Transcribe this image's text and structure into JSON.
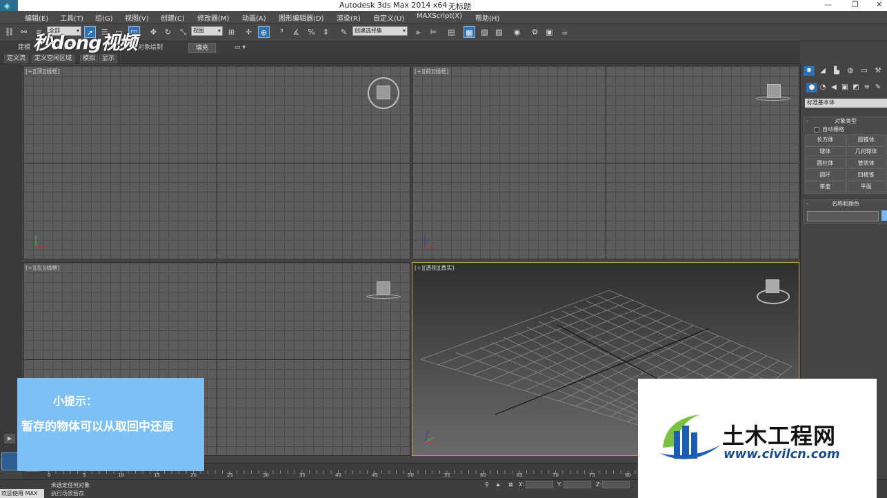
{
  "window": {
    "title": "Autodesk 3ds Max  2014 x64",
    "document": "无标题",
    "controls": [
      "—",
      "❐",
      "✕"
    ]
  },
  "menu": [
    "编辑(E)",
    "工具(T)",
    "组(G)",
    "视图(V)",
    "创建(C)",
    "修改器(M)",
    "动画(A)",
    "图形编辑器(D)",
    "渲染(R)",
    "自定义(U)",
    "MAXScript(X)",
    "帮助(H)"
  ],
  "toolbar": {
    "filter_select": "全部",
    "ref_coord": "视图",
    "selection_set": "创建选择集"
  },
  "ribbon": {
    "tabs": [
      "建模",
      "自由形式",
      "选择",
      "对象绘制",
      "填充"
    ],
    "subtabs": [
      "定义流",
      "定义空闲区域",
      "模拟",
      "显示"
    ]
  },
  "viewports": [
    {
      "label": "[+][顶][线框]"
    },
    {
      "label": "[+][前][线框]"
    },
    {
      "label": "[+][左][线框]"
    },
    {
      "label": "[+][透视][真实]"
    }
  ],
  "command_panel": {
    "category": "标准基本体",
    "object_type_title": "对象类型",
    "autogrid": "自动栅格",
    "buttons": [
      "长方体",
      "圆锥体",
      "球体",
      "几何球体",
      "圆柱体",
      "管状体",
      "圆环",
      "四棱锥",
      "茶壶",
      "平面"
    ],
    "name_color_title": "名称和颜色"
  },
  "timeline": {
    "labels": [
      "0",
      "5",
      "10",
      "15",
      "20",
      "25",
      "30",
      "35",
      "40",
      "45",
      "50",
      "55",
      "60",
      "65",
      "70",
      "75",
      "80"
    ]
  },
  "status": {
    "welcome": "欢迎使用 MAX",
    "selection": "未选定任何对象",
    "prompt": "执行场景暂存",
    "x_label": "X:",
    "y_label": "Y:",
    "z_label": "Z:"
  },
  "overlays": {
    "watermark": "秒dong视频",
    "tip_title": "小提示：",
    "tip_text": "暂存的物体可以从取回中还原",
    "logo_name": "土木工程网",
    "logo_url": "www.civilcn.com"
  }
}
